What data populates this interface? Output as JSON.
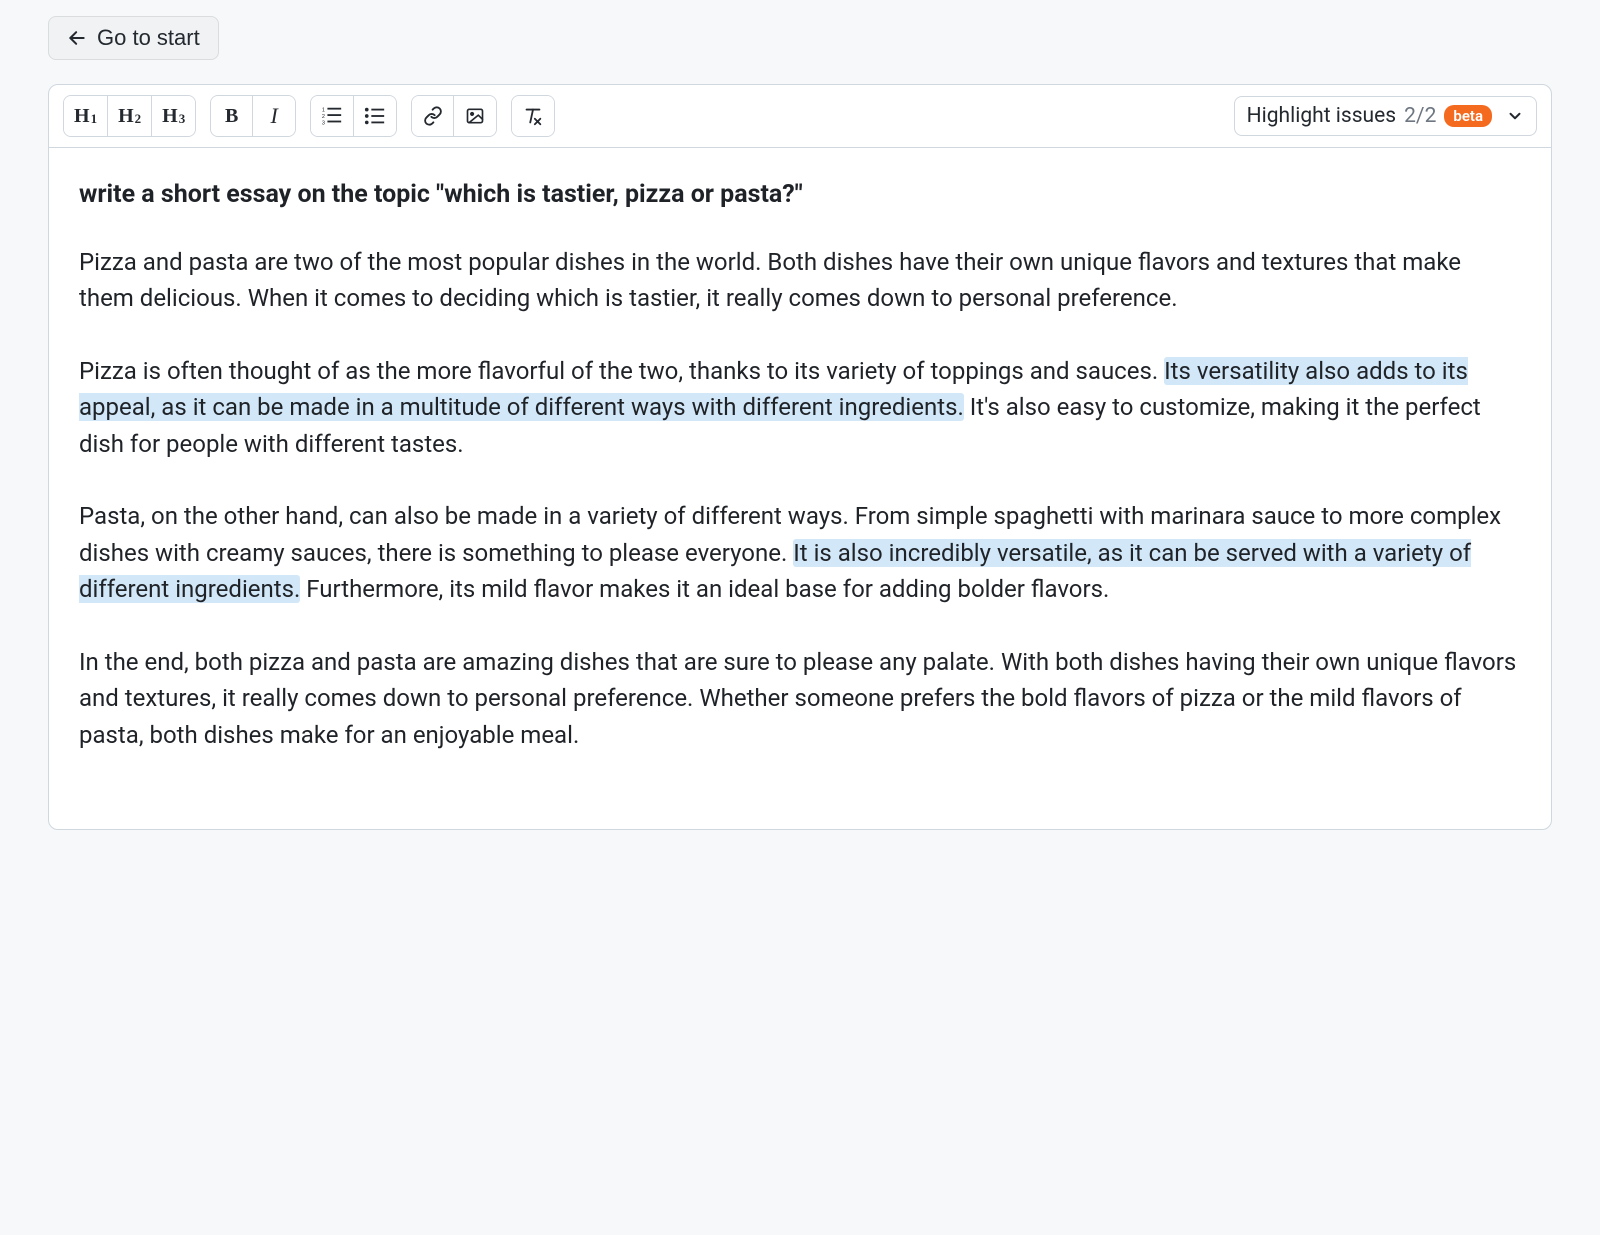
{
  "nav": {
    "go_to_start_label": "Go to start"
  },
  "toolbar": {
    "headings": [
      "1",
      "2",
      "3"
    ],
    "icons": {
      "h_prefix": "H",
      "bold": "B",
      "italic": "I",
      "ordered_list": "ordered-list",
      "unordered_list": "unordered-list",
      "link": "link",
      "image": "image",
      "clear_format": "clear-format"
    },
    "highlight_issues": {
      "label": "Highlight issues",
      "count": "2/2",
      "badge": "beta"
    }
  },
  "content": {
    "heading": "write a short essay on the topic \"which is tastier, pizza or pasta?\"",
    "p1": "Pizza and pasta are two of the most popular dishes in the world. Both dishes have their own unique flavors and textures that make them delicious. When it comes to deciding which is tastier, it really comes down to personal preference.",
    "p2_pre": "Pizza is often thought of as the more flavorful of the two, thanks to its variety of toppings and sauces. ",
    "p2_highlight": "Its versatility also adds to its appeal, as it can be made in a multitude of different ways with different ingredients.",
    "p2_post": " It's also easy to customize, making it the perfect dish for people with different tastes.",
    "p3_pre": "Pasta, on the other hand, can also be made in a variety of different ways. From simple spaghetti with marinara sauce to more complex dishes with creamy sauces, there is something to please everyone. ",
    "p3_highlight": "It is also incredibly versatile, as it can be served with a variety of different ingredients.",
    "p3_post": " Furthermore, its mild flavor makes it an ideal base for adding bolder flavors.",
    "p4": "In the end, both pizza and pasta are amazing dishes that are sure to please any palate. With both dishes having their own unique flavors and textures, it really comes down to personal preference. Whether someone prefers the bold flavors of pizza or the mild flavors of pasta, both dishes make for an enjoyable meal."
  }
}
